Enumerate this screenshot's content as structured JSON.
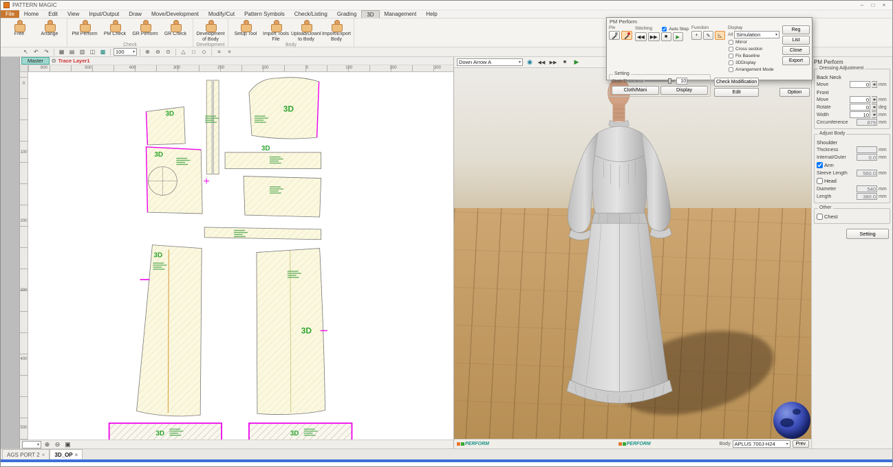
{
  "window": {
    "title": "PATTERN MAGIC",
    "minimize": "–",
    "maximize": "□",
    "close": "×"
  },
  "menubar": {
    "items": [
      "File",
      "Home",
      "Edit",
      "View",
      "Input/Output",
      "Draw",
      "Move/Development",
      "Modify/Cut",
      "Pattern Symbols",
      "Check/Listing",
      "Grading",
      "3D",
      "Management",
      "Help"
    ]
  },
  "ribbon": {
    "buttons": [
      "Free",
      "Arrange",
      "PM Perform",
      "PM Check",
      "GR Perform",
      "GR Check",
      "Development of Body",
      "Setup Tool",
      "Import Tools File",
      "Upload/Download to Body",
      "Import/Export Body"
    ],
    "groups": [
      "Check",
      "Development",
      "Body"
    ]
  },
  "quickbar": {
    "zoom_value": "100"
  },
  "icons": {
    "eye": "⊙",
    "caret": "▾",
    "back": "◀◀",
    "fwd": "▶▶",
    "stop": "■",
    "play": "▶",
    "snapshot": "◉",
    "zoom_in": "⊕",
    "zoom_out": "⊖",
    "zoom_fit": "▣",
    "select": "↖",
    "undo": "↶",
    "redo": "↷",
    "grid": "▦",
    "rows": "▤",
    "cols": "▥",
    "overlay": "◫",
    "hatch": "▩",
    "tri": "△",
    "rect": "□",
    "diam": "◇",
    "list": "≡",
    "close": "×",
    "plus": "+",
    "pen": "✎",
    "angle": "◺",
    "target": "⊙"
  },
  "canvas2d": {
    "layer_tab": "Master",
    "trace_label": "Trace Layer1",
    "piece_label": "3D",
    "ruler_top": [
      "600",
      "500",
      "400",
      "300",
      "200",
      "100",
      "0",
      "100",
      "200",
      "300"
    ],
    "ruler_left": [
      "0",
      "100",
      "200",
      "300",
      "400",
      "500"
    ]
  },
  "viewer3d": {
    "view_preset": "Down Arrow A",
    "logo_text": "PERFORM",
    "body_label": "Body",
    "body_value": "APLUS 700J-H24",
    "prev_button": "Prev"
  },
  "dialog": {
    "title": "PM Perform",
    "pin_label": "Pin",
    "stitching_label": "Stitching",
    "auto_stop_label": "Auto Stop",
    "auto_stop_checked": true,
    "function_label": "Function",
    "display_label": "Display",
    "display_all_label": "All",
    "display_select_value": "Simulation",
    "cb_mirror": "Mirror",
    "cb_cross": "Cross section",
    "cb_baseline": "Fix Baseline",
    "cb_3d": "3DDisplay",
    "cb_arrange": "Arrangement Mode",
    "btn_reg": "Reg",
    "btn_list": "List",
    "btn_close": "Close",
    "btn_export": "Export",
    "setting_label": "Setting",
    "cloth_thickness_label": "Cloth Thickness",
    "cloth_thickness_value": "10",
    "btn_cloth_mani": "Cloth/Mani",
    "btn_display": "Display",
    "btn_check_mod": "Check Modification",
    "btn_edit": "Edit",
    "btn_option": "Option"
  },
  "sidebar": {
    "title": "PM Perform",
    "group_dressing": "Dressing Adjustment",
    "back_neck_label": "Back Neck",
    "bn_move_label": "Move",
    "bn_move_value": "0",
    "bn_move_unit": "mm",
    "front_label": "Front",
    "f_move_label": "Move",
    "f_move_value": "0",
    "f_move_unit": "mm",
    "f_rotate_label": "Rotate",
    "f_rotate_value": "0",
    "f_rotate_unit": "deg",
    "f_width_label": "Width",
    "f_width_value": "10",
    "f_width_unit": "mm",
    "f_circ_label": "Circumference",
    "f_circ_value": "879",
    "f_circ_unit": "mm",
    "group_adjust": "Adjust Body",
    "shoulder_label": "Shoulder",
    "s_thick_label": "Thickness",
    "s_thick_value": "",
    "s_thick_unit": "mm",
    "s_inout_label": "Internal/Outer",
    "s_inout_value": "0.0",
    "s_inout_unit": "mm",
    "arm_label": "Arm",
    "arm_checked": true,
    "a_sleeve_label": "Sleeve Length",
    "a_sleeve_value": "560.0",
    "a_sleeve_unit": "mm",
    "head_label": "Head",
    "head_checked": false,
    "h_diam_label": "Diameter",
    "h_diam_value": "540",
    "h_diam_unit": "mm",
    "h_len_label": "Length",
    "h_len_value": "380.0",
    "h_len_unit": "mm",
    "other_label": "Other",
    "chest_label": "Chest",
    "chest_checked": false,
    "setting_button": "Setting"
  },
  "tabbar": {
    "tab1": "AGS PORT 2",
    "tab2": "3D_OP",
    "close_glyph": "×"
  }
}
